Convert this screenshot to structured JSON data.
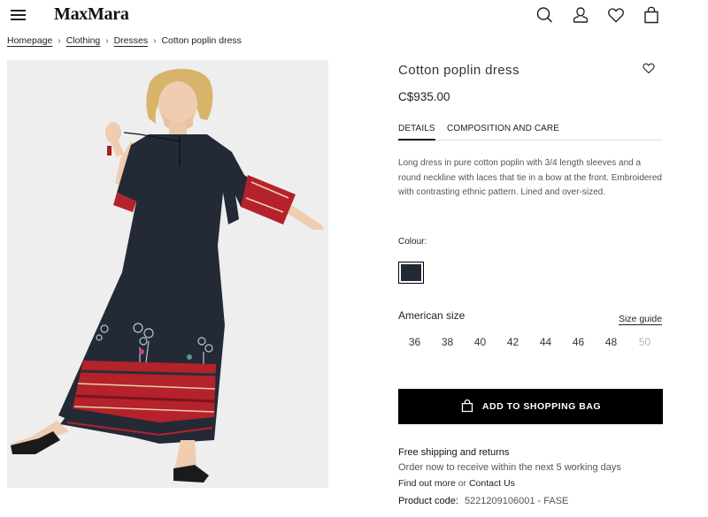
{
  "header": {
    "logo": "MaxMara",
    "icons": [
      "menu-icon",
      "search-icon",
      "account-icon",
      "wishlist-icon",
      "shopping-bag-icon"
    ]
  },
  "breadcrumb": {
    "items": [
      "Homepage",
      "Clothing",
      "Dresses"
    ],
    "current": "Cotton poplin dress"
  },
  "product": {
    "title": "Cotton poplin dress",
    "price": "C$935.00",
    "tabs": [
      "DETAILS",
      "COMPOSITION AND CARE"
    ],
    "description": "Long dress in pure cotton poplin with 3/4 length sleeves and a round neckline with laces that tie in a bow at the front. Embroidered with contrasting ethnic pattern. Lined and over-sized.",
    "colour_label": "Colour:",
    "colour_hex": "#232a36",
    "size_title": "American size",
    "size_guide": "Size guide",
    "sizes": [
      "36",
      "38",
      "40",
      "42",
      "44",
      "46",
      "48",
      "50"
    ],
    "unavailable_sizes": [
      "50"
    ],
    "add_to_bag": "ADD TO SHOPPING BAG",
    "shipping_title": "Free shipping and returns",
    "shipping_text": "Order now to receive within the next 5 working days",
    "find_out_more": "Find out more",
    "or_text": "or",
    "contact_us": "Contact Us",
    "product_code_label": "Product code:",
    "product_code_value": "5221209106001 - FASE"
  },
  "colors": {
    "button_bg": "#000000",
    "dress": "#232a36",
    "embroidery_red": "#b5222b"
  }
}
